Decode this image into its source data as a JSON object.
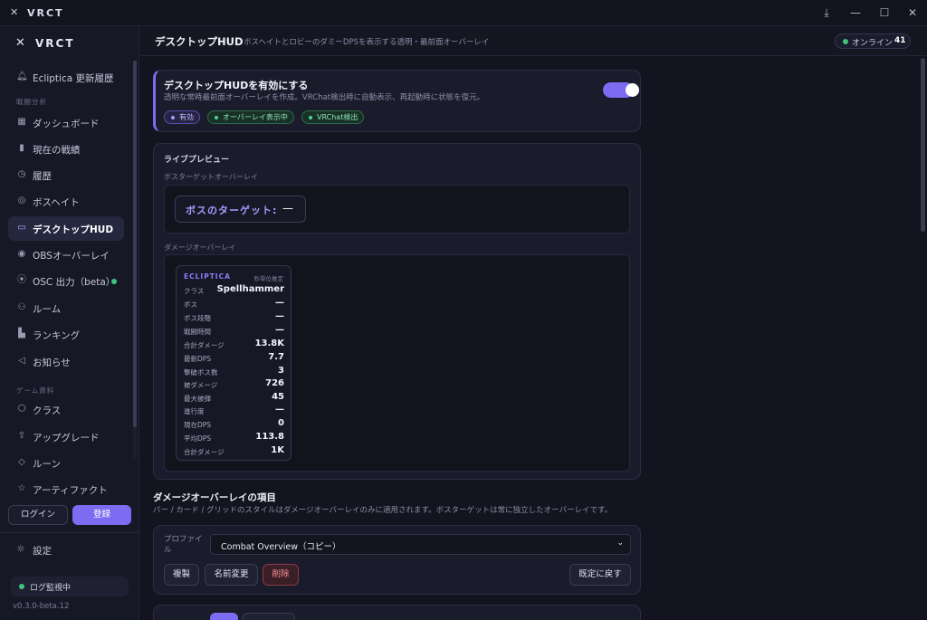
{
  "window": {
    "title": "VRCT",
    "icon": "wrench-cross-icon",
    "controls": [
      "download-icon",
      "minimize-icon",
      "maximize-icon",
      "close-icon"
    ]
  },
  "sidebar": {
    "brand": "VRCT",
    "top_item": {
      "label": "Ecliptica 更新履歴",
      "icon": "bell-icon"
    },
    "section_analysis": "戦闘分析",
    "analysis_items": [
      {
        "label": "ダッシュボード",
        "icon": "grid-icon"
      },
      {
        "label": "現在の戦績",
        "icon": "bar-chart-icon"
      },
      {
        "label": "履歴",
        "icon": "clock-icon"
      },
      {
        "label": "ボスヘイト",
        "icon": "target-icon"
      },
      {
        "label": "デスクトップHUD",
        "icon": "monitor-icon",
        "active": true
      },
      {
        "label": "OBSオーバーレイ",
        "icon": "obs-icon"
      },
      {
        "label": "OSC 出力（beta）",
        "icon": "broadcast-icon",
        "status": "online"
      },
      {
        "label": "ルーム",
        "icon": "users-icon"
      },
      {
        "label": "ランキング",
        "icon": "ranking-icon"
      },
      {
        "label": "お知らせ",
        "icon": "megaphone-icon"
      }
    ],
    "section_game": "ゲーム資料",
    "game_items": [
      {
        "label": "クラス",
        "icon": "shield-icon"
      },
      {
        "label": "アップグレード",
        "icon": "arrow-up-icon"
      },
      {
        "label": "ルーン",
        "icon": "diamond-icon"
      },
      {
        "label": "アーティファクト",
        "icon": "star-icon"
      }
    ],
    "login_label": "ログイン",
    "register_label": "登録",
    "settings_label": "設定",
    "log_status": "ログ監視中",
    "version": "v0.3.0-beta.12"
  },
  "header": {
    "title": "デスクトップHUD",
    "subtitle": "ボスヘイトとロビーのダミーDPSを表示する透明・最前面オーバーレイ",
    "online_label": "オンライン",
    "online_count": "41"
  },
  "hud_toggle": {
    "title": "デスクトップHUDを有効にする",
    "description": "透明な常時最前面オーバーレイを作成。VRChat検出時に自動表示、再起動時に状態を復元。",
    "enabled": true,
    "chips": [
      "有効",
      "オーバーレイ表示中",
      "VRChat検出"
    ]
  },
  "preview": {
    "title": "ライブプレビュー",
    "boss_section": "ボスターゲットオーバーレイ",
    "boss_label": "ボスのターゲット:",
    "boss_value": "—",
    "damage_section": "ダメージオーバーレイ",
    "damage": {
      "brand": "ECLIPTICA",
      "note": "秒単位推定",
      "rows": [
        {
          "k": "クラス",
          "v": "Spellhammer"
        },
        {
          "k": "ボス",
          "v": "—"
        },
        {
          "k": "ボス段階",
          "v": "—"
        },
        {
          "k": "戦闘時間",
          "v": "—"
        },
        {
          "k": "合計ダメージ",
          "v": "13.8K"
        },
        {
          "k": "最新DPS",
          "v": "7.7"
        },
        {
          "k": "撃破ボス数",
          "v": "3"
        },
        {
          "k": "被ダメージ",
          "v": "726"
        },
        {
          "k": "最大被弾",
          "v": "45"
        },
        {
          "k": "進行度",
          "v": "—"
        },
        {
          "k": "現在DPS",
          "v": "0"
        },
        {
          "k": "平均DPS",
          "v": "113.8"
        },
        {
          "k": "合計ダメージ",
          "v": "1K"
        }
      ]
    }
  },
  "items_section": {
    "title": "ダメージオーバーレイの項目",
    "description": "バー / カード / グリッドのスタイルはダメージオーバーレイのみに適用されます。ボスターゲットは常に独立したオーバーレイです。"
  },
  "profile": {
    "label": "プロファイル",
    "selected": "Combat Overview（コピー）",
    "duplicate_label": "複製",
    "rename_label": "名前変更",
    "delete_label": "削除",
    "reset_label": "既定に戻す"
  },
  "colors": {
    "accent": "#7d6cf2",
    "online": "#3fc47c",
    "danger": "#ff8f9c"
  }
}
